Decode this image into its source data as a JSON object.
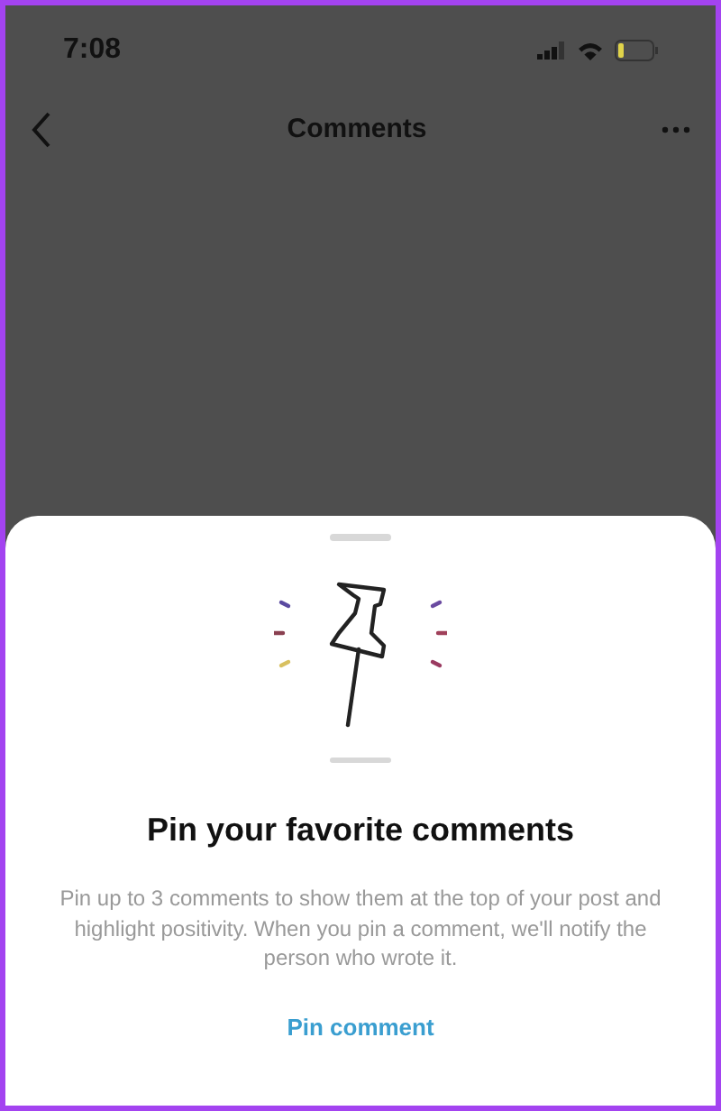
{
  "status_bar": {
    "time": "7:08"
  },
  "nav": {
    "title": "Comments"
  },
  "sheet": {
    "title": "Pin your favorite comments",
    "description": "Pin up to 3 comments to show them at the top of your post and highlight positivity. When you pin a comment, we'll notify the person who wrote it.",
    "action": "Pin comment"
  }
}
